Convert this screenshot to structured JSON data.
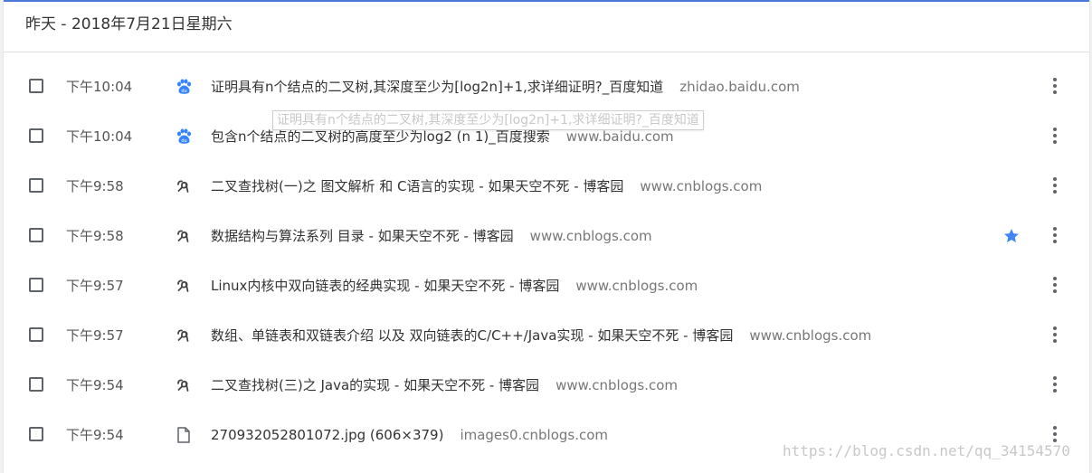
{
  "header": {
    "date_label": "昨天 - 2018年7月21日星期六"
  },
  "colors": {
    "accent": "#4a78d6",
    "baidu_blue": "#3385ff",
    "star": "#4285f4",
    "text": "#333333",
    "domain": "#777777"
  },
  "tooltip": {
    "text": "证明具有n个结点的二叉树,其深度至少为[log2n]+1,求详细证明?_百度知道"
  },
  "rows": [
    {
      "time": "下午10:04",
      "icon": "baidu-paw-icon",
      "title": "证明具有n个结点的二叉树,其深度至少为[log2n]+1,求详细证明?_百度知道",
      "domain": "zhidao.baidu.com",
      "starred": false
    },
    {
      "time": "下午10:04",
      "icon": "baidu-paw-icon",
      "title": "包含n个结点的二叉树的高度至少为log2 (n 1)_百度搜索",
      "domain": "www.baidu.com",
      "starred": false
    },
    {
      "time": "下午9:58",
      "icon": "cnblogs-icon",
      "title": "二叉查找树(一)之 图文解析 和 C语言的实现 - 如果天空不死 - 博客园",
      "domain": "www.cnblogs.com",
      "starred": false
    },
    {
      "time": "下午9:58",
      "icon": "cnblogs-icon",
      "title": "数据结构与算法系列 目录 - 如果天空不死 - 博客园",
      "domain": "www.cnblogs.com",
      "starred": true
    },
    {
      "time": "下午9:57",
      "icon": "cnblogs-icon",
      "title": "Linux内核中双向链表的经典实现 - 如果天空不死 - 博客园",
      "domain": "www.cnblogs.com",
      "starred": false
    },
    {
      "time": "下午9:57",
      "icon": "cnblogs-icon",
      "title": "数组、单链表和双链表介绍 以及 双向链表的C/C++/Java实现 - 如果天空不死 - 博客园",
      "domain": "www.cnblogs.com",
      "starred": false
    },
    {
      "time": "下午9:54",
      "icon": "cnblogs-icon",
      "title": "二叉查找树(三)之 Java的实现 - 如果天空不死 - 博客园",
      "domain": "www.cnblogs.com",
      "starred": false
    },
    {
      "time": "下午9:54",
      "icon": "file-icon",
      "title": "270932052801072.jpg (606×379)",
      "domain": "images0.cnblogs.com",
      "starred": false
    }
  ],
  "watermark": "https://blog.csdn.net/qq_34154570"
}
